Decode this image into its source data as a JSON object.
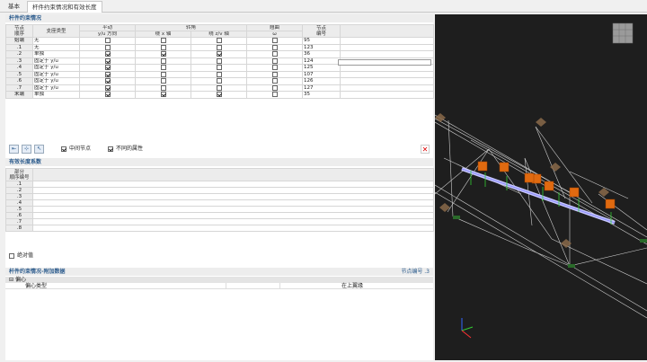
{
  "tabs": [
    "基本",
    "杆件约束情况和有效长度"
  ],
  "sec1": {
    "title": "杆件约束情况",
    "headers": {
      "node_order": "节点\n顺序",
      "support_type": "支座类型",
      "translation": "平动",
      "translation_sub": "y/u 方向",
      "rotation": "转角",
      "rot_x": "绕 x 轴",
      "rot_zv": "绕 z/v 轴",
      "warping": "翘曲",
      "warping_sub": "ω",
      "node_no": "节点\n编号"
    },
    "rows": [
      {
        "order": "始端",
        "type": "无",
        "t": false,
        "rx": false,
        "rz": false,
        "w": false,
        "node": "95"
      },
      {
        "order": ".1",
        "type": "无",
        "t": false,
        "rx": false,
        "rz": false,
        "w": false,
        "node": "123"
      },
      {
        "order": ".2",
        "type": "单独",
        "t": true,
        "rx": true,
        "rz": true,
        "w": false,
        "node": "36"
      },
      {
        "order": ".3",
        "type": "固定于 y/u",
        "t": true,
        "rx": false,
        "rz": false,
        "w": false,
        "node": "124"
      },
      {
        "order": ".4",
        "type": "固定于 y/u",
        "t": true,
        "rx": false,
        "rz": false,
        "w": false,
        "node": "125"
      },
      {
        "order": ".5",
        "type": "固定于 y/u",
        "t": true,
        "rx": false,
        "rz": false,
        "w": false,
        "node": "107"
      },
      {
        "order": ".6",
        "type": "固定于 y/u",
        "t": true,
        "rx": false,
        "rz": false,
        "w": false,
        "node": "126"
      },
      {
        "order": ".7",
        "type": "固定于 y/u",
        "t": true,
        "rx": false,
        "rz": false,
        "w": false,
        "node": "127"
      },
      {
        "order": "末端",
        "type": "单独",
        "t": true,
        "rx": true,
        "rz": true,
        "w": false,
        "node": "35"
      }
    ]
  },
  "toolbar": {
    "opt1_label": "中间节点",
    "opt1_checked": true,
    "opt2_label": "不同的属性",
    "opt2_checked": true
  },
  "sec2": {
    "title": "有效长度系数",
    "header": "部分\n顺序编号",
    "rows": [
      ".1",
      ".2",
      ".3",
      ".4",
      ".5",
      ".6",
      ".7",
      ".8"
    ],
    "abs_label": "绝对值"
  },
  "sec3": {
    "title": "杆件约束情况-附加数据",
    "right_info": "节点编号 .3",
    "group": "偏心",
    "col1": "偏心类型",
    "col2": "在上翼缘"
  }
}
